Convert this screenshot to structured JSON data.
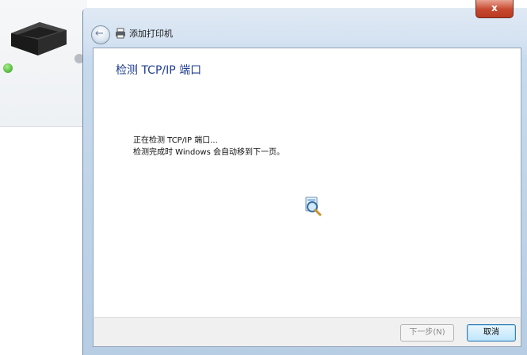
{
  "window": {
    "title": "添加打印机",
    "close_label": "x"
  },
  "content": {
    "heading": "检测 TCP/IP 端口",
    "status_line1": "正在检测 TCP/IP 端口...",
    "status_line2": "检测完成时 Windows 会自动移到下一页。"
  },
  "buttons": {
    "next": "下一步(N)",
    "next_enabled": false,
    "cancel": "取消"
  },
  "icons": {
    "back": "back-arrow-icon",
    "title": "printer-icon",
    "progress": "search-magnifier-icon",
    "background_printer": "printer-device-icon"
  },
  "colors": {
    "heading": "#1e3d8f",
    "close_button": "#c7472e",
    "cancel_border": "#3c7fb1"
  }
}
